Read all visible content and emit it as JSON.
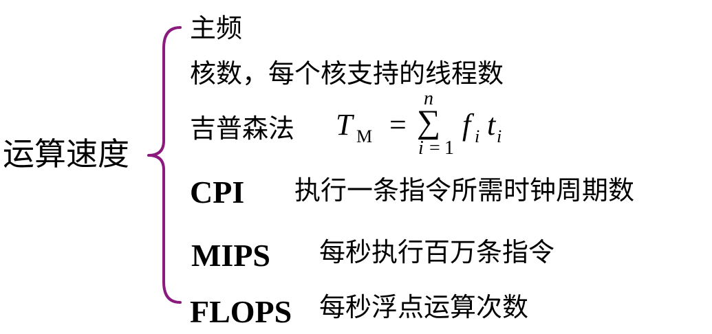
{
  "root": {
    "label": "运算速度"
  },
  "colors": {
    "brace": "#8B1A7E",
    "text": "#000000"
  },
  "items": {
    "clock": {
      "label": "主频"
    },
    "cores": {
      "label": "核数，每个核支持的线程数"
    },
    "gibson": {
      "label": "吉普森法",
      "formula": {
        "lhs_symbol": "T",
        "lhs_subscript": "M",
        "equals": "=",
        "sum_symbol": "∑",
        "sum_upper": "n",
        "sum_lower_var": "i",
        "sum_lower_eq": "=",
        "sum_lower_val": "1",
        "term1": "f",
        "term1_sub": "i",
        "term2": "t",
        "term2_sub": "i"
      }
    },
    "cpi": {
      "abbr": "CPI",
      "desc": "执行一条指令所需时钟周期数"
    },
    "mips": {
      "abbr": "MIPS",
      "desc": "每秒执行百万条指令"
    },
    "flops": {
      "abbr": "FLOPS",
      "desc": "每秒浮点运算次数"
    }
  }
}
